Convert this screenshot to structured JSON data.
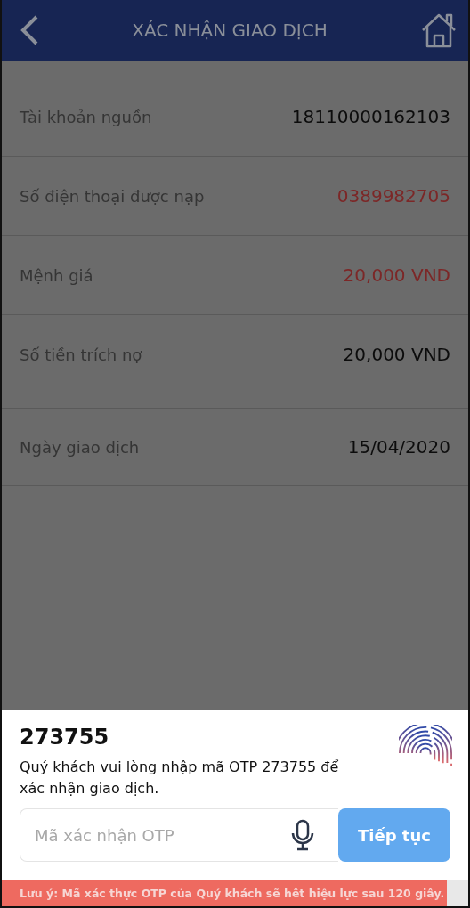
{
  "header": {
    "title": "XÁC NHẬN GIAO DỊCH"
  },
  "details": [
    {
      "label": "Tài khoản nguồn",
      "value": "18110000162103",
      "highlight": false
    },
    {
      "label": "Số điện thoại được nạp",
      "value": "0389982705",
      "highlight": true
    },
    {
      "label": "Mệnh giá",
      "value": "20,000 VND",
      "highlight": true
    },
    {
      "label": "Số tiền trích nợ",
      "value": "20,000 VND",
      "highlight": false
    },
    {
      "label": "Ngày giao dịch",
      "value": "15/04/2020",
      "highlight": false
    }
  ],
  "otp_sheet": {
    "code": "273755",
    "message": "Quý khách vui lòng nhập mã OTP 273755 để xác nhận giao dịch.",
    "placeholder": "Mã xác nhận OTP",
    "button": "Tiếp tục"
  },
  "notice": "Lưu ý: Mã xác thực OTP của Quý khách sẽ hết hiệu lực sau 120 giây."
}
